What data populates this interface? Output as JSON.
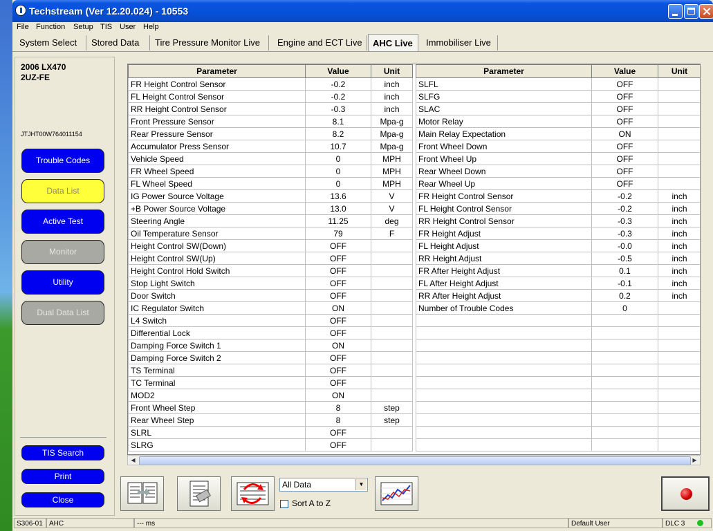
{
  "window": {
    "title": "Techstream (Ver 12.20.024) - 10553"
  },
  "menu": [
    "File",
    "Function",
    "Setup",
    "TIS",
    "User",
    "Help"
  ],
  "tabs": [
    "System Select",
    "Stored Data",
    "Tire Pressure Monitor Live",
    "Engine and ECT Live",
    "AHC Live",
    "Immobiliser Live"
  ],
  "active_tab": "AHC Live",
  "vehicle": {
    "model": "2006 LX470",
    "engine": "2UZ-FE",
    "vin": "JTJHT00W764011154"
  },
  "side_buttons": [
    "Trouble Codes",
    "Data List",
    "Active Test",
    "Monitor",
    "Utility",
    "Dual Data List"
  ],
  "bottom_buttons": [
    "TIS Search",
    "Print",
    "Close"
  ],
  "table_headers": {
    "parameter": "Parameter",
    "value": "Value",
    "unit": "Unit"
  },
  "left_rows": [
    [
      "FR Height Control Sensor",
      "-0.2",
      "inch"
    ],
    [
      "FL Height Control Sensor",
      "-0.2",
      "inch"
    ],
    [
      "RR Height Control Sensor",
      "-0.3",
      "inch"
    ],
    [
      "Front Pressure Sensor",
      "8.1",
      "Mpa-g"
    ],
    [
      "Rear Pressure Sensor",
      "8.2",
      "Mpa-g"
    ],
    [
      "Accumulator Press Sensor",
      "10.7",
      "Mpa-g"
    ],
    [
      "Vehicle Speed",
      "0",
      "MPH"
    ],
    [
      "FR Wheel Speed",
      "0",
      "MPH"
    ],
    [
      "FL Wheel Speed",
      "0",
      "MPH"
    ],
    [
      "IG Power Source Voltage",
      "13.6",
      "V"
    ],
    [
      "+B Power Source Voltage",
      "13.0",
      "V"
    ],
    [
      "Steering Angle",
      "11.25",
      "deg"
    ],
    [
      "Oil Temperature Sensor",
      "79",
      "F"
    ],
    [
      "Height Control SW(Down)",
      "OFF",
      ""
    ],
    [
      "Height Control SW(Up)",
      "OFF",
      ""
    ],
    [
      "Height Control Hold Switch",
      "OFF",
      ""
    ],
    [
      "Stop Light Switch",
      "OFF",
      ""
    ],
    [
      "Door Switch",
      "OFF",
      ""
    ],
    [
      "IC Regulator Switch",
      "ON",
      ""
    ],
    [
      "L4 Switch",
      "OFF",
      ""
    ],
    [
      "Differential Lock",
      "OFF",
      ""
    ],
    [
      "Damping Force Switch 1",
      "ON",
      ""
    ],
    [
      "Damping Force Switch 2",
      "OFF",
      ""
    ],
    [
      "TS Terminal",
      "OFF",
      ""
    ],
    [
      "TC Terminal",
      "OFF",
      ""
    ],
    [
      "MOD2",
      "ON",
      ""
    ],
    [
      "Front Wheel Step",
      "8",
      "step"
    ],
    [
      "Rear Wheel Step",
      "8",
      "step"
    ],
    [
      "SLRL",
      "OFF",
      ""
    ],
    [
      "SLRG",
      "OFF",
      ""
    ]
  ],
  "right_rows": [
    [
      "SLFL",
      "OFF",
      ""
    ],
    [
      "SLFG",
      "OFF",
      ""
    ],
    [
      "SLAC",
      "OFF",
      ""
    ],
    [
      "Motor Relay",
      "OFF",
      ""
    ],
    [
      "Main Relay Expectation",
      "ON",
      ""
    ],
    [
      "Front Wheel Down",
      "OFF",
      ""
    ],
    [
      "Front Wheel Up",
      "OFF",
      ""
    ],
    [
      "Rear Wheel Down",
      "OFF",
      ""
    ],
    [
      "Rear Wheel Up",
      "OFF",
      ""
    ],
    [
      "FR Height Control Sensor",
      "-0.2",
      "inch"
    ],
    [
      "FL Height Control Sensor",
      "-0.2",
      "inch"
    ],
    [
      "RR Height Control Sensor",
      "-0.3",
      "inch"
    ],
    [
      "FR Height Adjust",
      "-0.3",
      "inch"
    ],
    [
      "FL Height Adjust",
      "-0.0",
      "inch"
    ],
    [
      "RR Height Adjust",
      "-0.5",
      "inch"
    ],
    [
      "FR After Height Adjust",
      "0.1",
      "inch"
    ],
    [
      "FL After Height Adjust",
      "-0.1",
      "inch"
    ],
    [
      "RR After Height Adjust",
      "0.2",
      "inch"
    ],
    [
      "Number of Trouble Codes",
      "0",
      ""
    ]
  ],
  "data_select": {
    "selected": "All Data"
  },
  "sort_label": "Sort A to Z",
  "status": {
    "code": "S306-01",
    "system": "AHC",
    "timing": "--- ms",
    "user": "Default User",
    "dlc": "DLC 3"
  },
  "icons": [
    "list-transfer-icon",
    "clipboard-icon",
    "refresh-list-icon",
    "graph-icon",
    "record-icon"
  ]
}
